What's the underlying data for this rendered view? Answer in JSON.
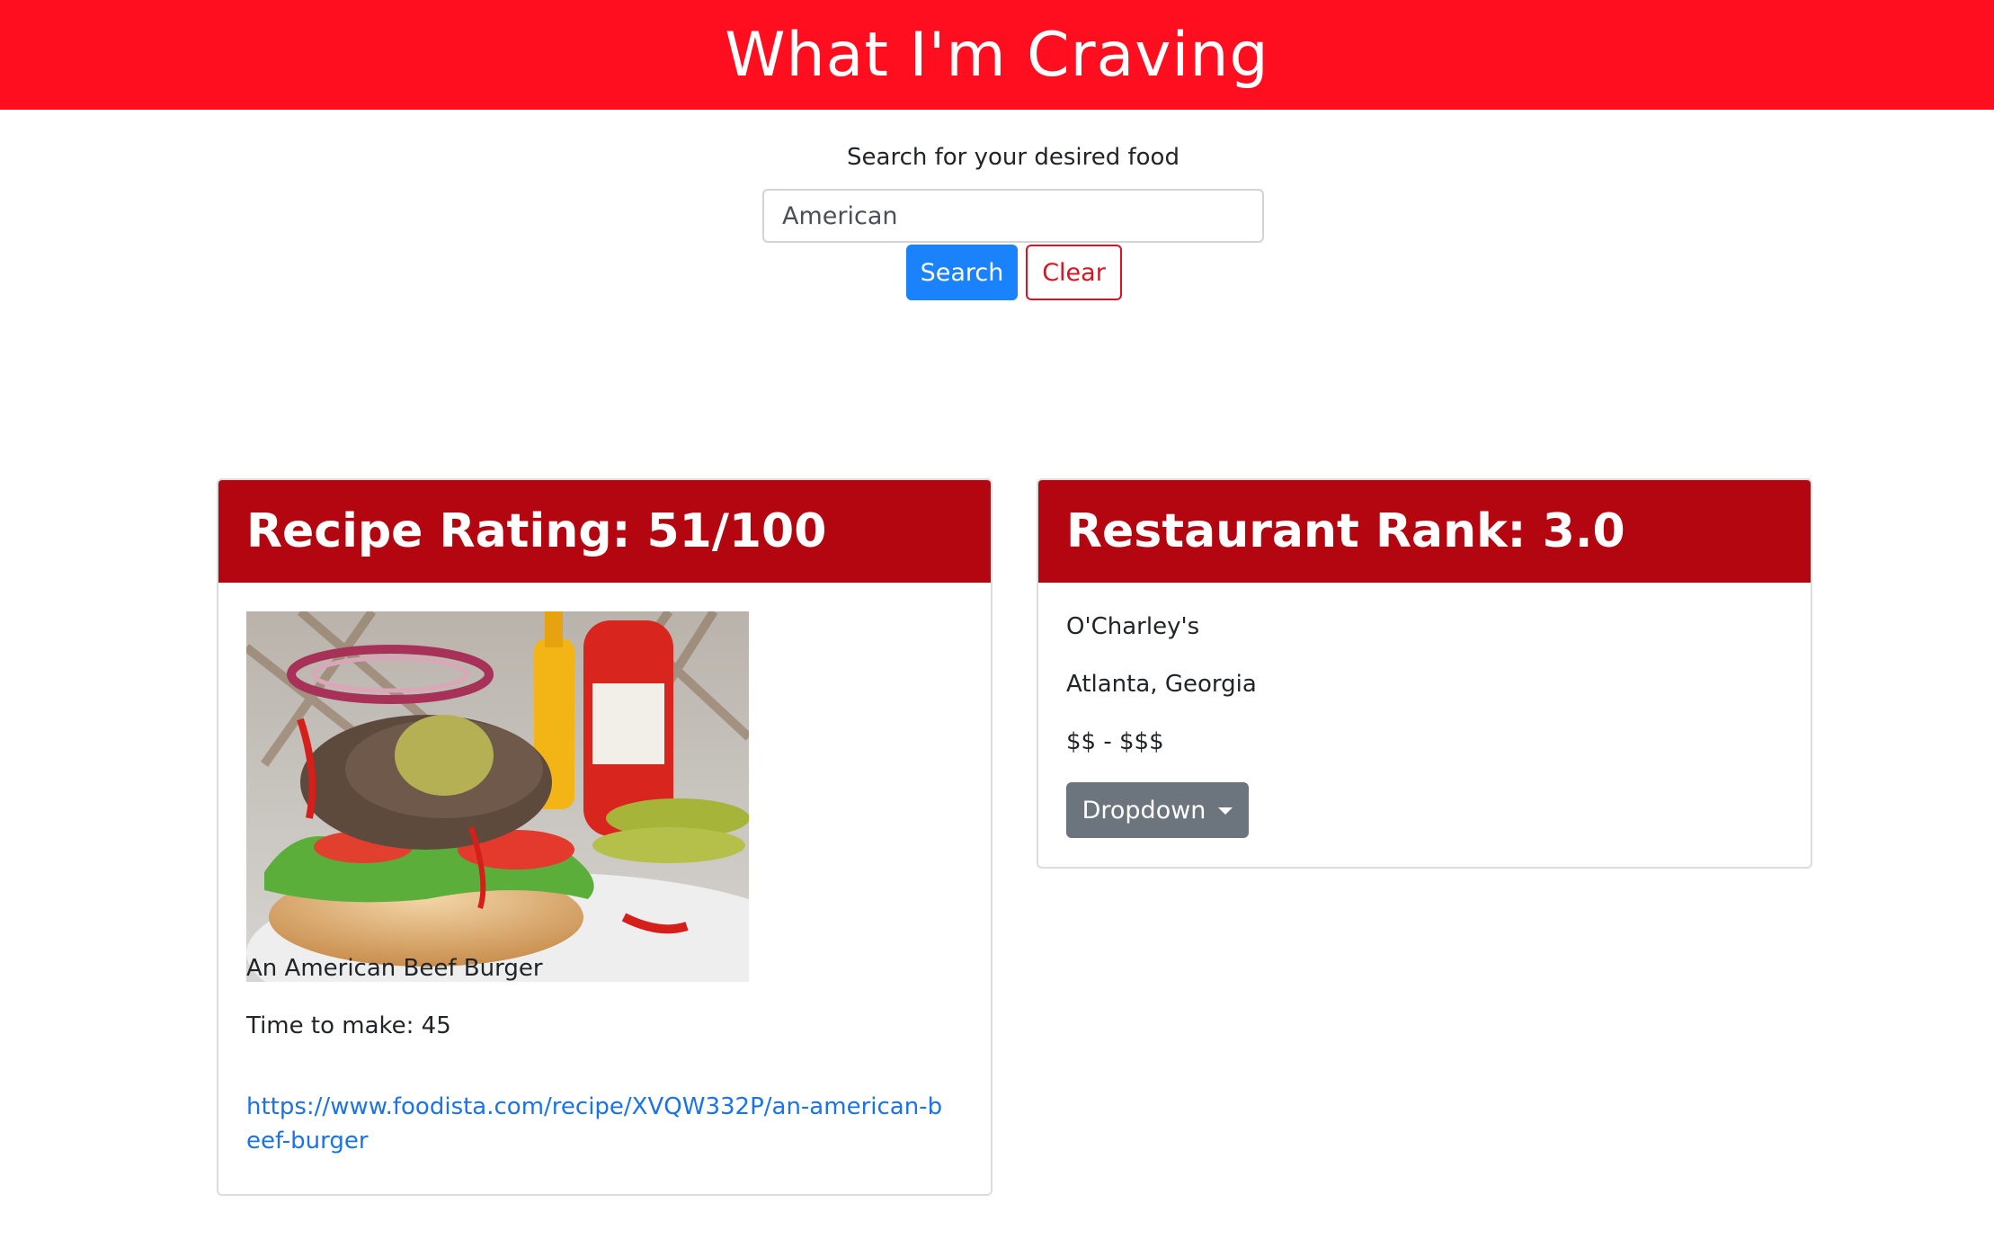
{
  "header": {
    "title": "What I'm Craving"
  },
  "search": {
    "label": "Search for your desired food",
    "value": "American",
    "search_button": "Search",
    "clear_button": "Clear"
  },
  "recipe_card": {
    "title": "Recipe Rating: 51/100",
    "image_icon": "burger-photo",
    "name": "An American Beef Burger",
    "time": "Time to make: 45",
    "link": "https://www.foodista.com/recipe/XVQW332P/an-american-beef-burger"
  },
  "restaurant_card": {
    "title": "Restaurant Rank: 3.0",
    "name": "O'Charley's",
    "location": "Atlanta, Georgia",
    "price": "$$ - $$$",
    "dropdown_label": "Dropdown"
  },
  "colors": {
    "brand_red": "#ff0e1f",
    "card_header_red": "#b30610",
    "primary_blue": "#1a82fb",
    "secondary_gray": "#6c757d",
    "link_blue": "#1a73e8"
  }
}
